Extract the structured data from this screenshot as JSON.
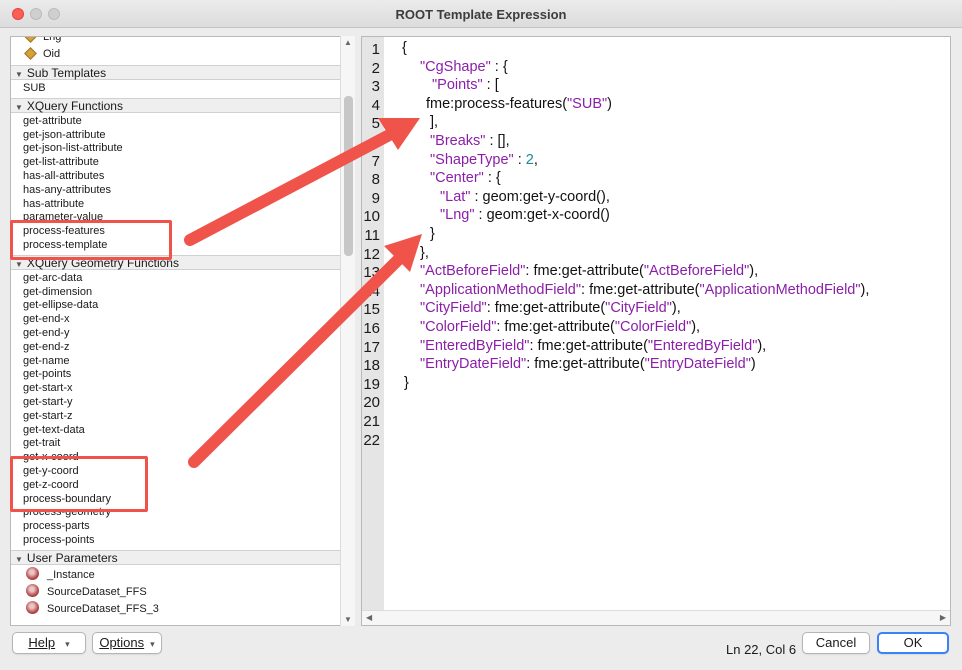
{
  "window": {
    "title": "ROOT Template Expression"
  },
  "tree": {
    "top_items": [
      "Lng",
      "Oid"
    ],
    "sections": [
      {
        "label": "Sub Templates",
        "items": [
          "SUB"
        ]
      },
      {
        "label": "XQuery Functions",
        "items": [
          "get-attribute",
          "get-json-attribute",
          "get-json-list-attribute",
          "get-list-attribute",
          "has-all-attributes",
          "has-any-attributes",
          "has-attribute",
          "parameter-value",
          "process-features",
          "process-template"
        ]
      },
      {
        "label": "XQuery Geometry Functions",
        "items": [
          "get-arc-data",
          "get-dimension",
          "get-ellipse-data",
          "get-end-x",
          "get-end-y",
          "get-end-z",
          "get-name",
          "get-points",
          "get-start-x",
          "get-start-y",
          "get-start-z",
          "get-text-data",
          "get-trait",
          "get-x-coord",
          "get-y-coord",
          "get-z-coord",
          "process-boundary",
          "process-geometry",
          "process-parts",
          "process-points"
        ]
      },
      {
        "label": "User Parameters",
        "items": [
          "_Instance",
          "SourceDataset_FFS",
          "SourceDataset_FFS_3"
        ]
      }
    ]
  },
  "editor": {
    "line_numbers": [
      "1",
      "2",
      "3",
      "4",
      "5",
      "6",
      "7",
      "8",
      "9",
      "10",
      "11",
      "12",
      "13",
      "14",
      "15",
      "16",
      "17",
      "18",
      "19",
      "20",
      "21",
      "22"
    ],
    "lines": [
      "{",
      "\"CgShape\" : {",
      "\"Points\" : [",
      "fme:process-features(\"SUB\")",
      "],",
      "\"Breaks\" : [],",
      "\"ShapeType\" : 2,",
      "\"Center\" : {",
      "\"Lat\" : geom:get-y-coord(),",
      "\"Lng\" : geom:get-x-coord()",
      "}",
      "},",
      "\"ActBeforeField\": fme:get-attribute(\"ActBeforeField\"),",
      "\"ApplicationMethodField\": fme:get-attribute(\"ApplicationMethodField\"),",
      "\"CityField\": fme:get-attribute(\"CityField\"),",
      "\"ColorField\": fme:get-attribute(\"ColorField\"),",
      "\"EnteredByField\": fme:get-attribute(\"EnteredByField\"),",
      "\"EntryDateField\": fme:get-attribute(\"EntryDateField\")",
      "}",
      "",
      "",
      ""
    ]
  },
  "footer": {
    "help_label": "Help",
    "options_label": "Options",
    "status": "Ln 22, Col 6",
    "cancel_label": "Cancel",
    "ok_label": "OK"
  },
  "colors": {
    "highlight": "#f0534a",
    "key": "#8b1fa8",
    "number": "#1a8a94",
    "ok_border": "#3b82f6"
  }
}
